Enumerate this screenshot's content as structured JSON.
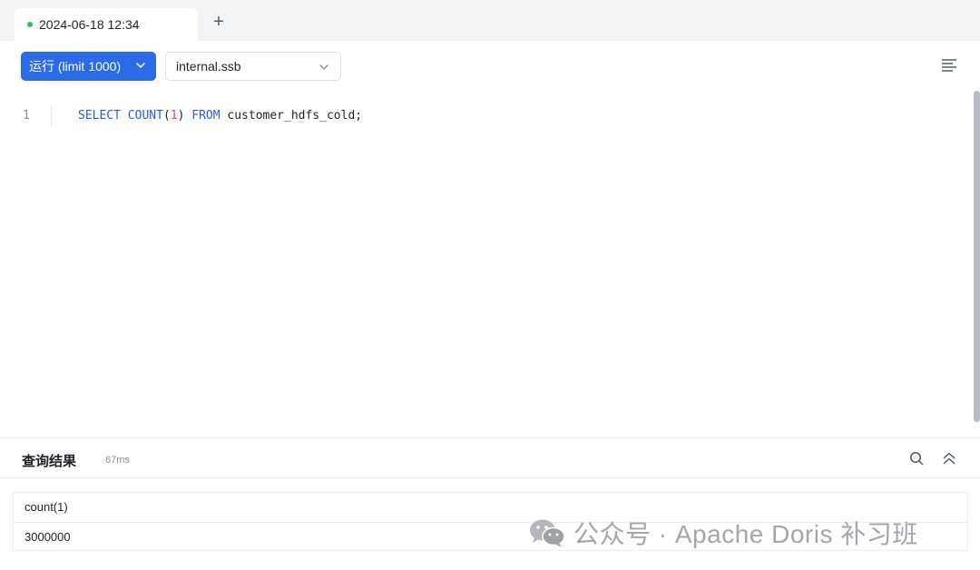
{
  "tab": {
    "label": "2024-06-18 12:34",
    "add_symbol": "+"
  },
  "toolbar": {
    "run_label": "运行 (limit 1000)",
    "database_value": "internal.ssb"
  },
  "editor": {
    "line_number": "1",
    "code_tokens": {
      "select": "SELECT",
      "count": "COUNT",
      "open": "(",
      "arg": "1",
      "close": ")",
      "from": "FROM",
      "rest": " customer_hdfs_cold;"
    }
  },
  "results": {
    "title": "查询结果",
    "time": "67ms",
    "columns": [
      "count(1)"
    ],
    "rows": [
      [
        "3000000"
      ]
    ]
  },
  "watermark": {
    "text": "公众号 · Apache Doris 补习班"
  },
  "colors": {
    "accent": "#2b6ae8",
    "keyword": "#2b5ce0",
    "number": "#d9534f",
    "status_dot": "#3fb950"
  }
}
